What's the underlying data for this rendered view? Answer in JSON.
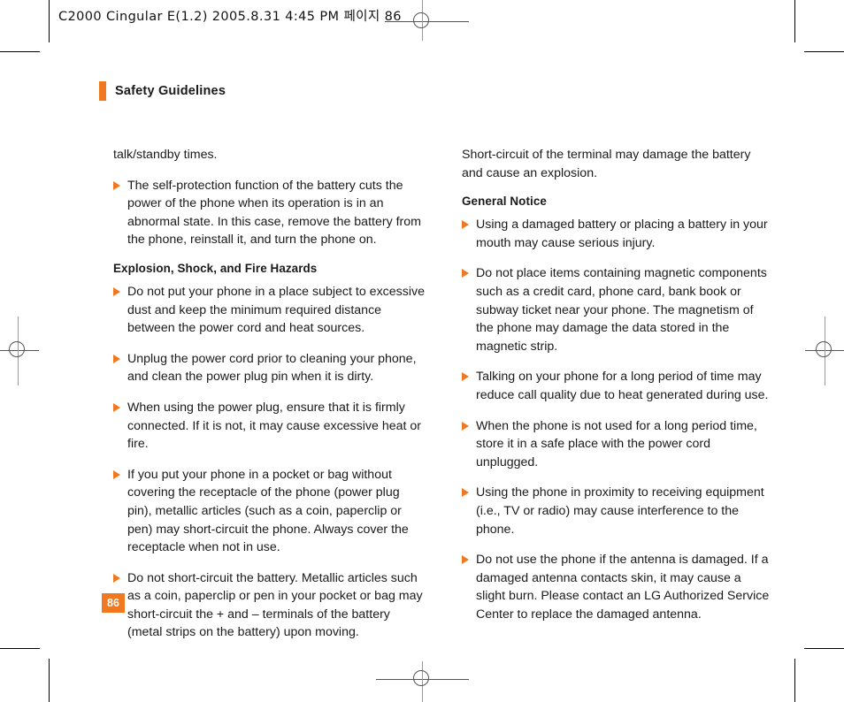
{
  "print_header": {
    "text": "C2000 Cingular  E(1.2)  2005.8.31 4:45 PM 페이지 86"
  },
  "section": {
    "title": "Safety Guidelines"
  },
  "page_number": "86",
  "colors": {
    "accent_orange": "#F07820",
    "body_text": "#1A1A1A",
    "page_background": "#FFFFFF"
  },
  "columns": {
    "left": [
      {
        "kind": "paragraph",
        "text": "talk/standby times."
      },
      {
        "kind": "bullet",
        "text": "The self-protection function of the battery cuts the power of the phone when its operation is in an abnormal state. In this case, remove the battery from the phone, reinstall it, and turn the phone on."
      },
      {
        "kind": "subheading",
        "text": "Explosion, Shock, and Fire Hazards"
      },
      {
        "kind": "bullet",
        "text": "Do not put your phone in a place subject to excessive dust and keep the minimum required distance between the power cord and heat sources."
      },
      {
        "kind": "bullet",
        "text": "Unplug the power cord prior to cleaning your phone, and clean the power plug pin when it is dirty."
      },
      {
        "kind": "bullet",
        "text": "When using the power plug, ensure that it is firmly connected. If it is not, it may cause excessive heat or fire."
      },
      {
        "kind": "bullet",
        "text": "If you put your phone in a pocket or bag without covering the receptacle of the phone (power plug pin), metallic articles (such as a coin, paperclip or pen) may short-circuit the phone. Always cover the receptacle when not in use."
      },
      {
        "kind": "bullet",
        "text": "Do not short-circuit the battery. Metallic articles such as a coin, paperclip or pen in your pocket or bag may short-circuit the + and – terminals of the battery (metal strips on the battery) upon moving."
      }
    ],
    "right": [
      {
        "kind": "paragraph",
        "text": "Short-circuit of the terminal may damage the battery and cause an explosion."
      },
      {
        "kind": "subheading",
        "text": "General Notice"
      },
      {
        "kind": "bullet",
        "text": "Using a damaged battery or placing a battery in your mouth may cause serious injury."
      },
      {
        "kind": "bullet",
        "text": "Do not place items containing magnetic components such as a credit card, phone card, bank book or subway ticket near your phone. The magnetism of the phone may damage the data stored in the magnetic strip."
      },
      {
        "kind": "bullet",
        "text": "Talking on your phone for a long period of time may reduce call quality due to heat generated during use."
      },
      {
        "kind": "bullet",
        "text": "When the phone is not used for a long period time, store it in a safe place with the power cord unplugged."
      },
      {
        "kind": "bullet",
        "text": "Using the phone in proximity to receiving equipment (i.e., TV or radio) may cause interference to the phone."
      },
      {
        "kind": "bullet",
        "text": "Do not use the phone if the antenna is damaged. If a damaged antenna contacts skin, it may cause a slight burn. Please contact an LG Authorized Service Center to replace the damaged antenna."
      }
    ]
  }
}
